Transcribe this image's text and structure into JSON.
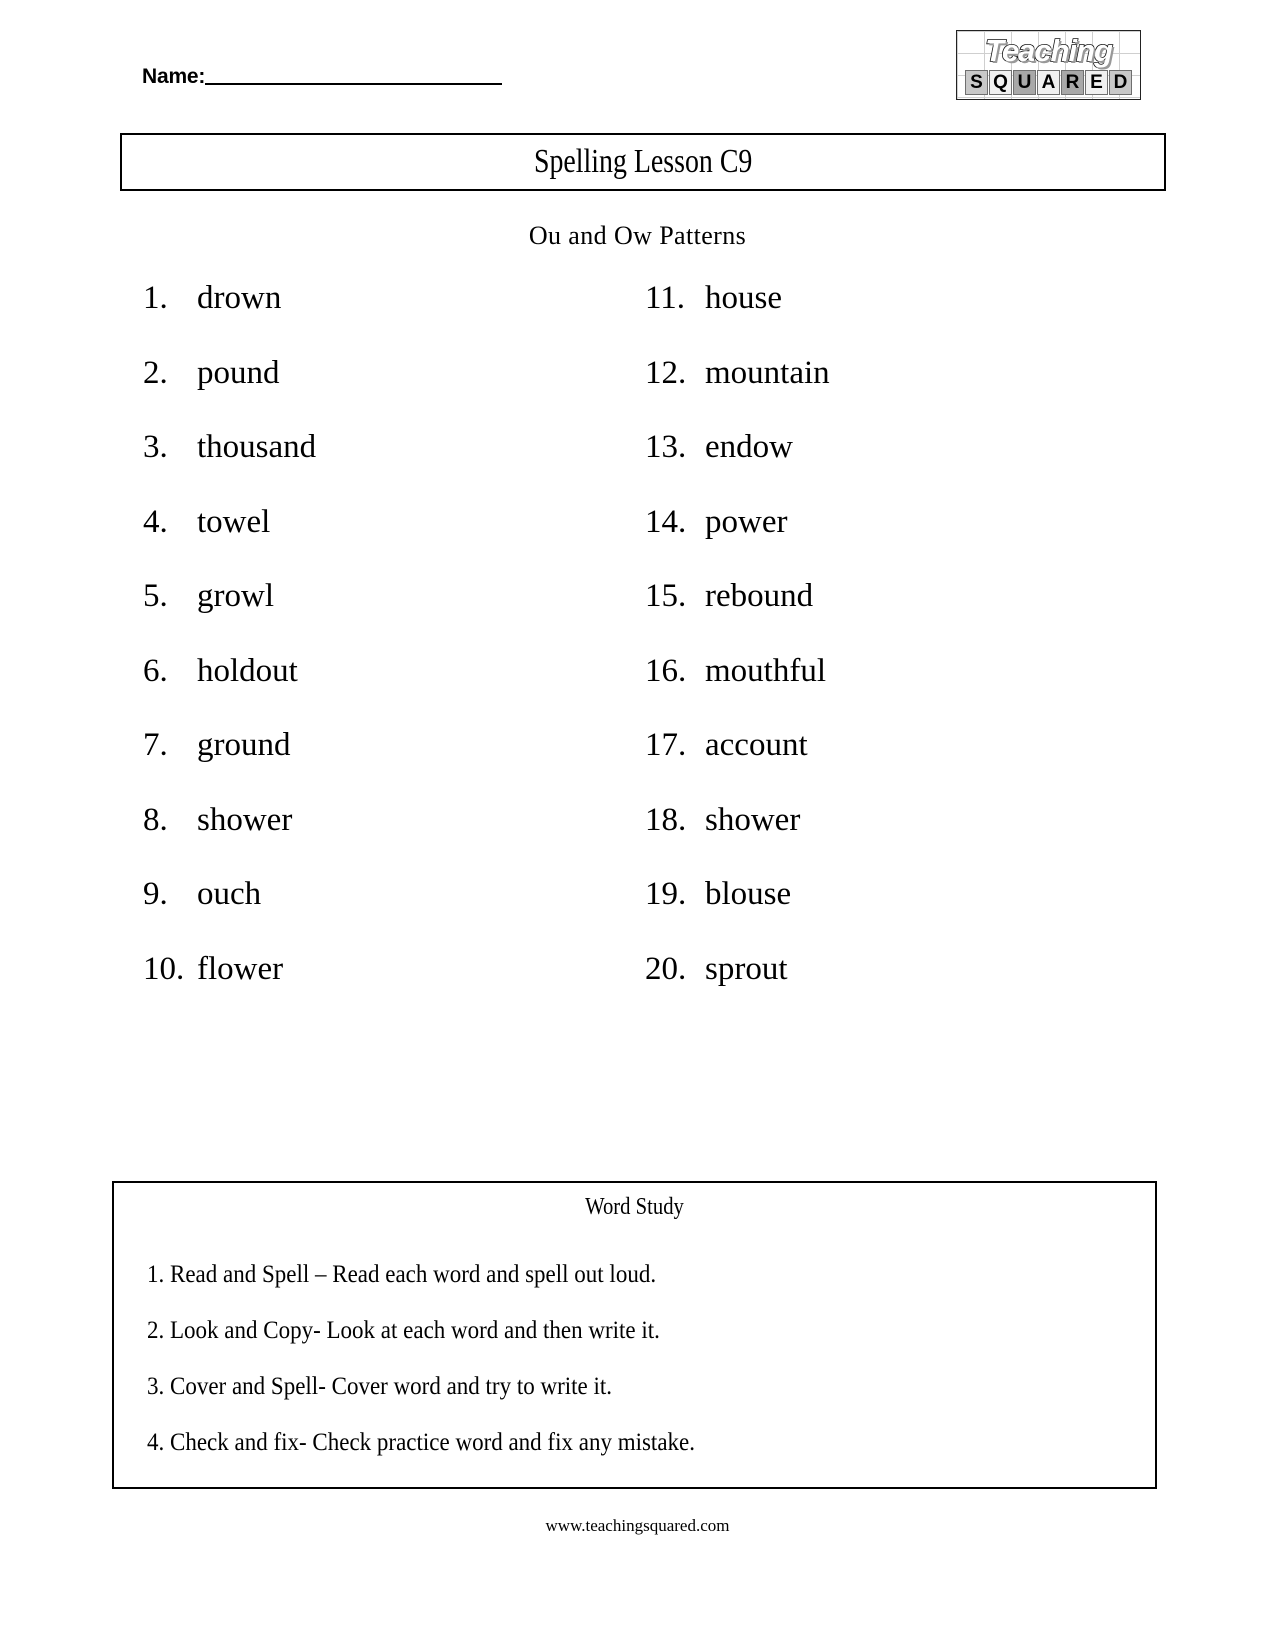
{
  "header": {
    "name_label": "Name:",
    "logo": {
      "top_text": "Teaching",
      "tiles": [
        "S",
        "Q",
        "U",
        "A",
        "R",
        "E",
        "D"
      ]
    }
  },
  "title": "Spelling Lesson C9",
  "subtitle": "Ou and Ow Patterns",
  "word_list": {
    "left_column": [
      {
        "num": "1.",
        "word": "drown"
      },
      {
        "num": "2.",
        "word": "pound"
      },
      {
        "num": "3.",
        "word": "thousand"
      },
      {
        "num": "4.",
        "word": "towel"
      },
      {
        "num": "5.",
        "word": "growl"
      },
      {
        "num": "6.",
        "word": "holdout"
      },
      {
        "num": "7.",
        "word": "ground"
      },
      {
        "num": "8.",
        "word": "shower"
      },
      {
        "num": "9.",
        "word": "ouch"
      },
      {
        "num": "10.",
        "word": "flower"
      }
    ],
    "right_column": [
      {
        "num": "11.",
        "word": "house"
      },
      {
        "num": "12.",
        "word": "mountain"
      },
      {
        "num": "13.",
        "word": "endow"
      },
      {
        "num": "14.",
        "word": "power"
      },
      {
        "num": "15.",
        "word": "rebound"
      },
      {
        "num": "16.",
        "word": "mouthful"
      },
      {
        "num": "17.",
        "word": "account"
      },
      {
        "num": "18.",
        "word": "shower"
      },
      {
        "num": "19.",
        "word": "blouse"
      },
      {
        "num": "20.",
        "word": "sprout"
      }
    ]
  },
  "word_study": {
    "title": "Word Study",
    "steps": [
      "1. Read and Spell – Read each word and spell out loud.",
      "2. Look and Copy- Look at each word and then write it.",
      "3. Cover and Spell- Cover word and try to write it.",
      "4. Check and fix- Check practice word and fix any mistake."
    ]
  },
  "footer": "www.teachingsquared.com"
}
